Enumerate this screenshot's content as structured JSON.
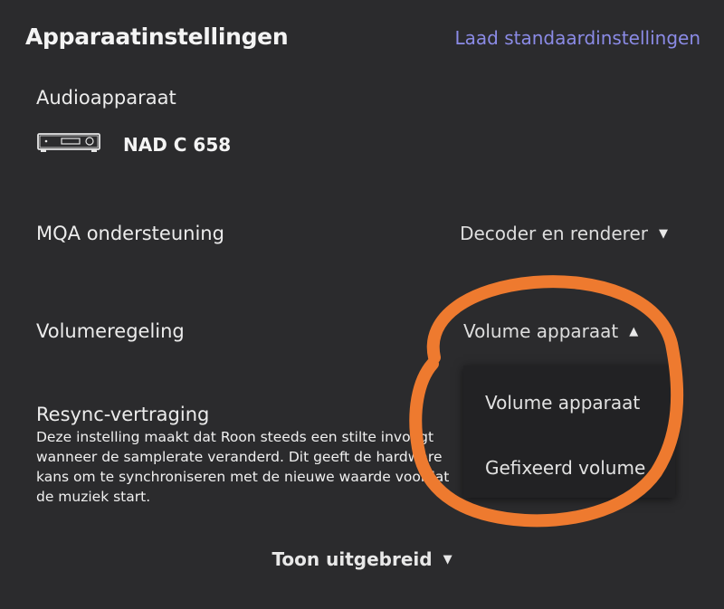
{
  "header": {
    "title": "Apparaatinstellingen",
    "reset_link": "Laad standaardinstellingen"
  },
  "audio_device": {
    "label": "Audioapparaat",
    "icon": "amplifier-icon",
    "name": "NAD C 658"
  },
  "mqa": {
    "label": "MQA ondersteuning",
    "value": "Decoder en renderer"
  },
  "volume": {
    "label": "Volumeregeling",
    "value": "Volume apparaat",
    "options": [
      "Volume apparaat",
      "Gefixeerd volume"
    ]
  },
  "resync": {
    "title": "Resync-vertraging",
    "description": "Deze instelling maakt dat Roon steeds een stilte invoegt wanneer de samplerate veranderd. Dit geeft de hardware kans om te synchroniseren met de nieuwe waarde voordat de muziek start."
  },
  "footer": {
    "advanced_toggle": "Toon uitgebreid"
  },
  "colors": {
    "background": "#2b2b2d",
    "link": "#8b8be6",
    "annotation": "#ee7a2f"
  }
}
